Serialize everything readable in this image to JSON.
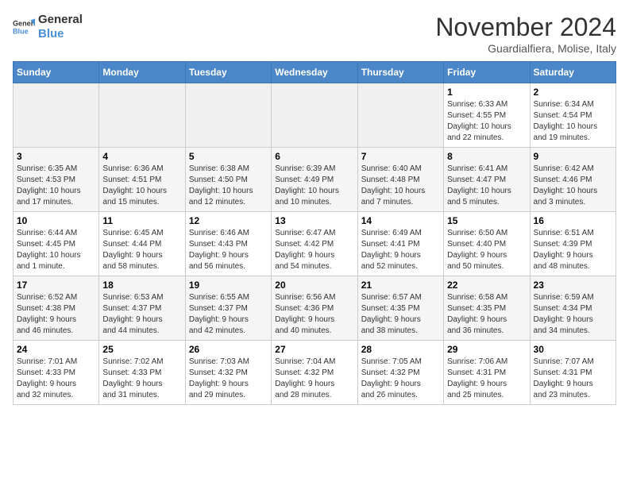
{
  "logo": {
    "line1": "General",
    "line2": "Blue"
  },
  "title": "November 2024",
  "location": "Guardialfiera, Molise, Italy",
  "days_of_week": [
    "Sunday",
    "Monday",
    "Tuesday",
    "Wednesday",
    "Thursday",
    "Friday",
    "Saturday"
  ],
  "weeks": [
    [
      {
        "day": "",
        "info": ""
      },
      {
        "day": "",
        "info": ""
      },
      {
        "day": "",
        "info": ""
      },
      {
        "day": "",
        "info": ""
      },
      {
        "day": "",
        "info": ""
      },
      {
        "day": "1",
        "info": "Sunrise: 6:33 AM\nSunset: 4:55 PM\nDaylight: 10 hours\nand 22 minutes."
      },
      {
        "day": "2",
        "info": "Sunrise: 6:34 AM\nSunset: 4:54 PM\nDaylight: 10 hours\nand 19 minutes."
      }
    ],
    [
      {
        "day": "3",
        "info": "Sunrise: 6:35 AM\nSunset: 4:53 PM\nDaylight: 10 hours\nand 17 minutes."
      },
      {
        "day": "4",
        "info": "Sunrise: 6:36 AM\nSunset: 4:51 PM\nDaylight: 10 hours\nand 15 minutes."
      },
      {
        "day": "5",
        "info": "Sunrise: 6:38 AM\nSunset: 4:50 PM\nDaylight: 10 hours\nand 12 minutes."
      },
      {
        "day": "6",
        "info": "Sunrise: 6:39 AM\nSunset: 4:49 PM\nDaylight: 10 hours\nand 10 minutes."
      },
      {
        "day": "7",
        "info": "Sunrise: 6:40 AM\nSunset: 4:48 PM\nDaylight: 10 hours\nand 7 minutes."
      },
      {
        "day": "8",
        "info": "Sunrise: 6:41 AM\nSunset: 4:47 PM\nDaylight: 10 hours\nand 5 minutes."
      },
      {
        "day": "9",
        "info": "Sunrise: 6:42 AM\nSunset: 4:46 PM\nDaylight: 10 hours\nand 3 minutes."
      }
    ],
    [
      {
        "day": "10",
        "info": "Sunrise: 6:44 AM\nSunset: 4:45 PM\nDaylight: 10 hours\nand 1 minute."
      },
      {
        "day": "11",
        "info": "Sunrise: 6:45 AM\nSunset: 4:44 PM\nDaylight: 9 hours\nand 58 minutes."
      },
      {
        "day": "12",
        "info": "Sunrise: 6:46 AM\nSunset: 4:43 PM\nDaylight: 9 hours\nand 56 minutes."
      },
      {
        "day": "13",
        "info": "Sunrise: 6:47 AM\nSunset: 4:42 PM\nDaylight: 9 hours\nand 54 minutes."
      },
      {
        "day": "14",
        "info": "Sunrise: 6:49 AM\nSunset: 4:41 PM\nDaylight: 9 hours\nand 52 minutes."
      },
      {
        "day": "15",
        "info": "Sunrise: 6:50 AM\nSunset: 4:40 PM\nDaylight: 9 hours\nand 50 minutes."
      },
      {
        "day": "16",
        "info": "Sunrise: 6:51 AM\nSunset: 4:39 PM\nDaylight: 9 hours\nand 48 minutes."
      }
    ],
    [
      {
        "day": "17",
        "info": "Sunrise: 6:52 AM\nSunset: 4:38 PM\nDaylight: 9 hours\nand 46 minutes."
      },
      {
        "day": "18",
        "info": "Sunrise: 6:53 AM\nSunset: 4:37 PM\nDaylight: 9 hours\nand 44 minutes."
      },
      {
        "day": "19",
        "info": "Sunrise: 6:55 AM\nSunset: 4:37 PM\nDaylight: 9 hours\nand 42 minutes."
      },
      {
        "day": "20",
        "info": "Sunrise: 6:56 AM\nSunset: 4:36 PM\nDaylight: 9 hours\nand 40 minutes."
      },
      {
        "day": "21",
        "info": "Sunrise: 6:57 AM\nSunset: 4:35 PM\nDaylight: 9 hours\nand 38 minutes."
      },
      {
        "day": "22",
        "info": "Sunrise: 6:58 AM\nSunset: 4:35 PM\nDaylight: 9 hours\nand 36 minutes."
      },
      {
        "day": "23",
        "info": "Sunrise: 6:59 AM\nSunset: 4:34 PM\nDaylight: 9 hours\nand 34 minutes."
      }
    ],
    [
      {
        "day": "24",
        "info": "Sunrise: 7:01 AM\nSunset: 4:33 PM\nDaylight: 9 hours\nand 32 minutes."
      },
      {
        "day": "25",
        "info": "Sunrise: 7:02 AM\nSunset: 4:33 PM\nDaylight: 9 hours\nand 31 minutes."
      },
      {
        "day": "26",
        "info": "Sunrise: 7:03 AM\nSunset: 4:32 PM\nDaylight: 9 hours\nand 29 minutes."
      },
      {
        "day": "27",
        "info": "Sunrise: 7:04 AM\nSunset: 4:32 PM\nDaylight: 9 hours\nand 28 minutes."
      },
      {
        "day": "28",
        "info": "Sunrise: 7:05 AM\nSunset: 4:32 PM\nDaylight: 9 hours\nand 26 minutes."
      },
      {
        "day": "29",
        "info": "Sunrise: 7:06 AM\nSunset: 4:31 PM\nDaylight: 9 hours\nand 25 minutes."
      },
      {
        "day": "30",
        "info": "Sunrise: 7:07 AM\nSunset: 4:31 PM\nDaylight: 9 hours\nand 23 minutes."
      }
    ]
  ]
}
